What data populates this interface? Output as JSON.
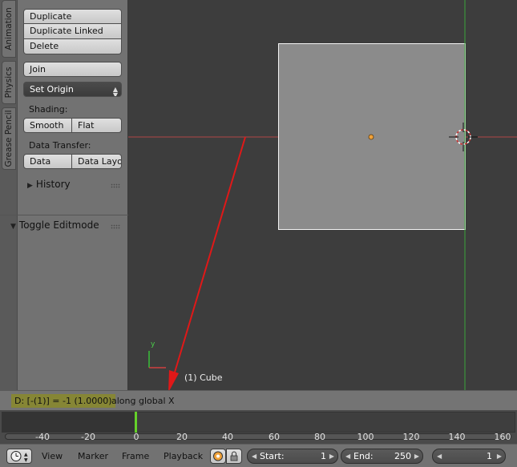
{
  "side_tabs": [
    "Animation",
    "Physics",
    "Grease Pencil"
  ],
  "tool_panel": {
    "duplicate": "Duplicate",
    "duplicate_linked": "Duplicate Linked",
    "delete": "Delete",
    "join": "Join",
    "set_origin": "Set Origin",
    "shading_label": "Shading:",
    "smooth": "Smooth",
    "flat": "Flat",
    "data_transfer_label": "Data Transfer:",
    "data": "Data",
    "data_layout": "Data Layo",
    "history": "History"
  },
  "operator_panel": {
    "title": "Toggle Editmode"
  },
  "viewport": {
    "object_info": "(1) Cube",
    "axis_y_label": "y",
    "colors": {
      "x_axis": "#b04848",
      "y_axis": "#3aa53a",
      "origin_dot": "#f0a23a",
      "arrow": "#e01818"
    }
  },
  "status": {
    "highlight": "D: [-(1)] = -1 (1.0000)",
    "rest": "along global X"
  },
  "timeline": {
    "ticks": [
      "-40",
      "-20",
      "0",
      "20",
      "40",
      "60",
      "80",
      "100",
      "120",
      "140",
      "160"
    ],
    "current_frame": 0,
    "playhead_color": "#65d12a"
  },
  "footer": {
    "menus": [
      "View",
      "Marker",
      "Frame",
      "Playback"
    ],
    "start_label": "Start:",
    "start_value": "1",
    "end_label": "End:",
    "end_value": "250",
    "current_value": "1"
  }
}
